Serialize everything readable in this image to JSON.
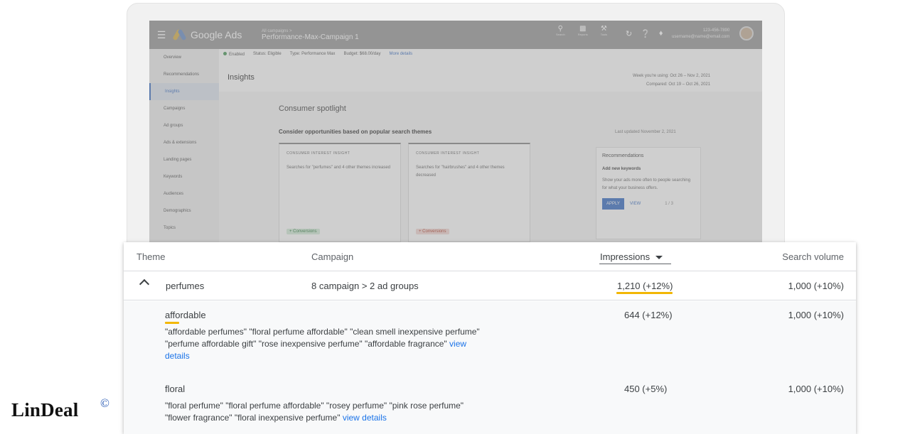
{
  "ads_window": {
    "app_name": "Google Ads",
    "breadcrumb_small": "All campaigns >",
    "campaign_title": "Performance-Max-Campaign 1",
    "top_icons": [
      {
        "icon": "search-icon",
        "label": "Search"
      },
      {
        "icon": "reports-icon",
        "label": "Reports"
      },
      {
        "icon": "tools-icon",
        "label": "Tools"
      }
    ],
    "account_id": "123-456-7890",
    "account_email": "username@name@email.com",
    "nav_items": [
      "Overview",
      "Recommendations",
      "Insights",
      "Campaigns",
      "Ad groups",
      "Ads & extensions",
      "Landing pages",
      "Keywords",
      "Audiences",
      "Demographics",
      "Topics"
    ],
    "active_nav": "Insights",
    "status": {
      "enabled": "Enabled",
      "status": "Status: Eligible",
      "type": "Type: Performance Max",
      "budget": "Budget: $68.00/day",
      "more": "More details"
    },
    "page_title": "Insights",
    "date_range": "Week you're using: Oct 26 – Nov 2, 2021",
    "compared": "Compared: Oct 19 – Oct 26, 2021",
    "section_title": "Consumer spotlight",
    "section_sub": "Consider opportunities based on popular search themes",
    "last_updated": "Last updated November 2, 2021",
    "cards": [
      {
        "head": "CONSUMER INTEREST INSIGHT",
        "body": "Searches for \"perfumes\" and 4 other themes increased",
        "pill": "+ Conversions"
      },
      {
        "head": "CONSUMER INTEREST INSIGHT",
        "body": "Searches for \"hairbrushes\" and 4 other themes decreased",
        "pill": "+ Conversions"
      }
    ],
    "recommendation": {
      "title": "Recommendations",
      "action": "Add new keywords",
      "body": "Show your ads more often to people searching for what your business offers.",
      "apply": "APPLY",
      "view": "VIEW",
      "pager": "1 / 3"
    }
  },
  "table": {
    "headers": {
      "theme": "Theme",
      "campaign": "Campaign",
      "impressions": "Impressions",
      "search_volume": "Search volume"
    },
    "main_row": {
      "theme": "perfumes",
      "campaign": "8 campaign > 2 ad groups",
      "impressions": "1,210 (+12%)",
      "search_volume": "1,000 (+10%)"
    },
    "sub_rows": [
      {
        "name": "affordable",
        "keywords": "\"affordable perfumes\" \"floral perfume affordable\" \"clean smell inexpensive perfume\" \"perfume affordable gift\" \"rose inexpensive perfume\" \"affordable fragrance\"",
        "link": "view details",
        "impressions": "644 (+12%)",
        "search_volume": "1,000 (+10%)"
      },
      {
        "name": "floral",
        "keywords": "\"floral perfume\" \"floral perfume affordable\" \"rosey perfume\" \"pink rose perfume\" \"flower fragrance\" \"floral inexpensive perfume\"",
        "link": "view details",
        "impressions": "450 (+5%)",
        "search_volume": "1,000 (+10%)"
      }
    ]
  },
  "watermark": {
    "text": "LinDeal",
    "symbol": "©"
  },
  "colors": {
    "highlight": "#f2b705",
    "link": "#1a73e8",
    "text": "#3c4043"
  }
}
